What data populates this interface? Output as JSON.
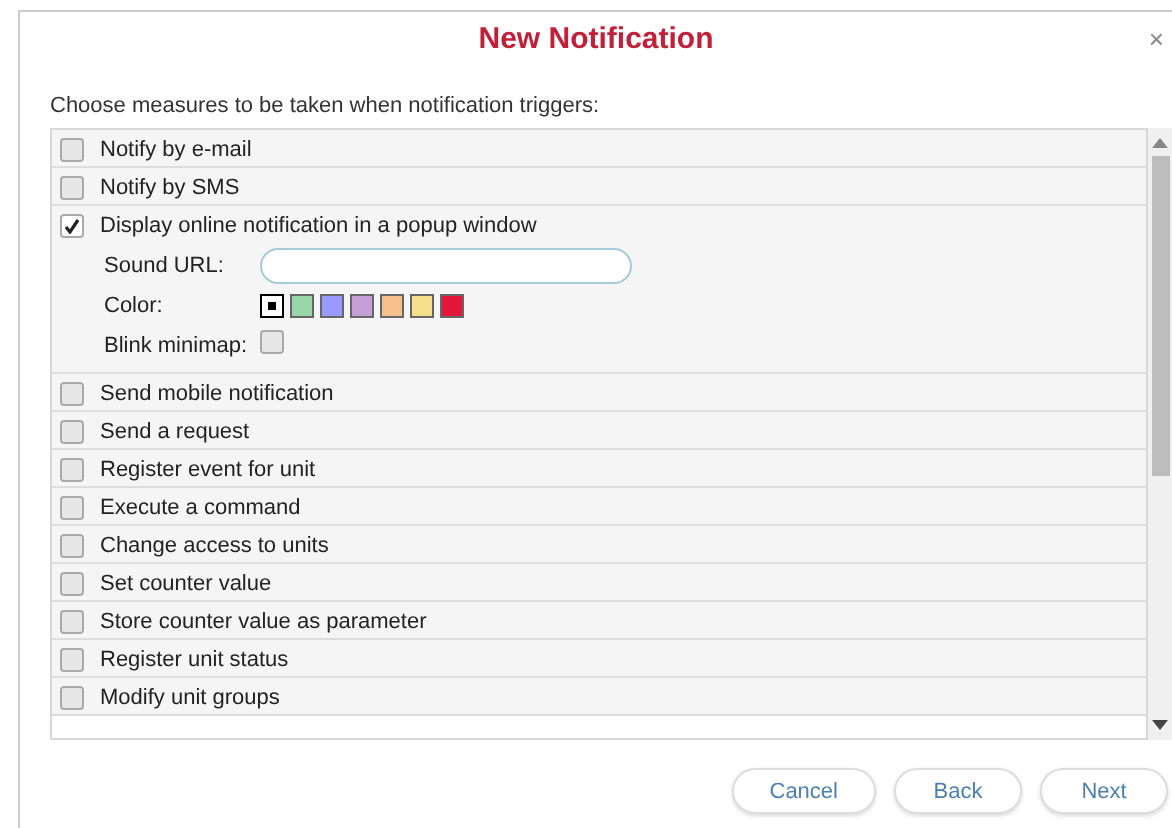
{
  "dialog": {
    "title": "New Notification",
    "close": "×",
    "instruction": "Choose measures to be taken when notification triggers:"
  },
  "actions": [
    {
      "label": "Notify by e-mail",
      "checked": false
    },
    {
      "label": "Notify by SMS",
      "checked": false
    },
    {
      "label": "Display online notification in a popup window",
      "checked": true,
      "options": {
        "sound_label": "Sound URL:",
        "color_label": "Color:",
        "colors": [
          {
            "color": "#ffffff",
            "selected": true
          },
          {
            "color": "#99d6a8",
            "selected": false
          },
          {
            "color": "#9999ff",
            "selected": false
          },
          {
            "color": "#c39fd6",
            "selected": false
          },
          {
            "color": "#f8bf8c",
            "selected": false
          },
          {
            "color": "#f7e08c",
            "selected": false
          },
          {
            "color": "#e3173a",
            "selected": false
          }
        ],
        "blink_label": "Blink minimap:",
        "blink_checked": false
      }
    },
    {
      "label": "Send mobile notification",
      "checked": false
    },
    {
      "label": "Send a request",
      "checked": false
    },
    {
      "label": "Register event for unit",
      "checked": false
    },
    {
      "label": "Execute a command",
      "checked": false
    },
    {
      "label": "Change access to units",
      "checked": false
    },
    {
      "label": "Set counter value",
      "checked": false
    },
    {
      "label": "Store counter value as parameter",
      "checked": false
    },
    {
      "label": "Register unit status",
      "checked": false
    },
    {
      "label": "Modify unit groups",
      "checked": false
    }
  ],
  "buttons": [
    "Cancel",
    "Back",
    "Next"
  ]
}
